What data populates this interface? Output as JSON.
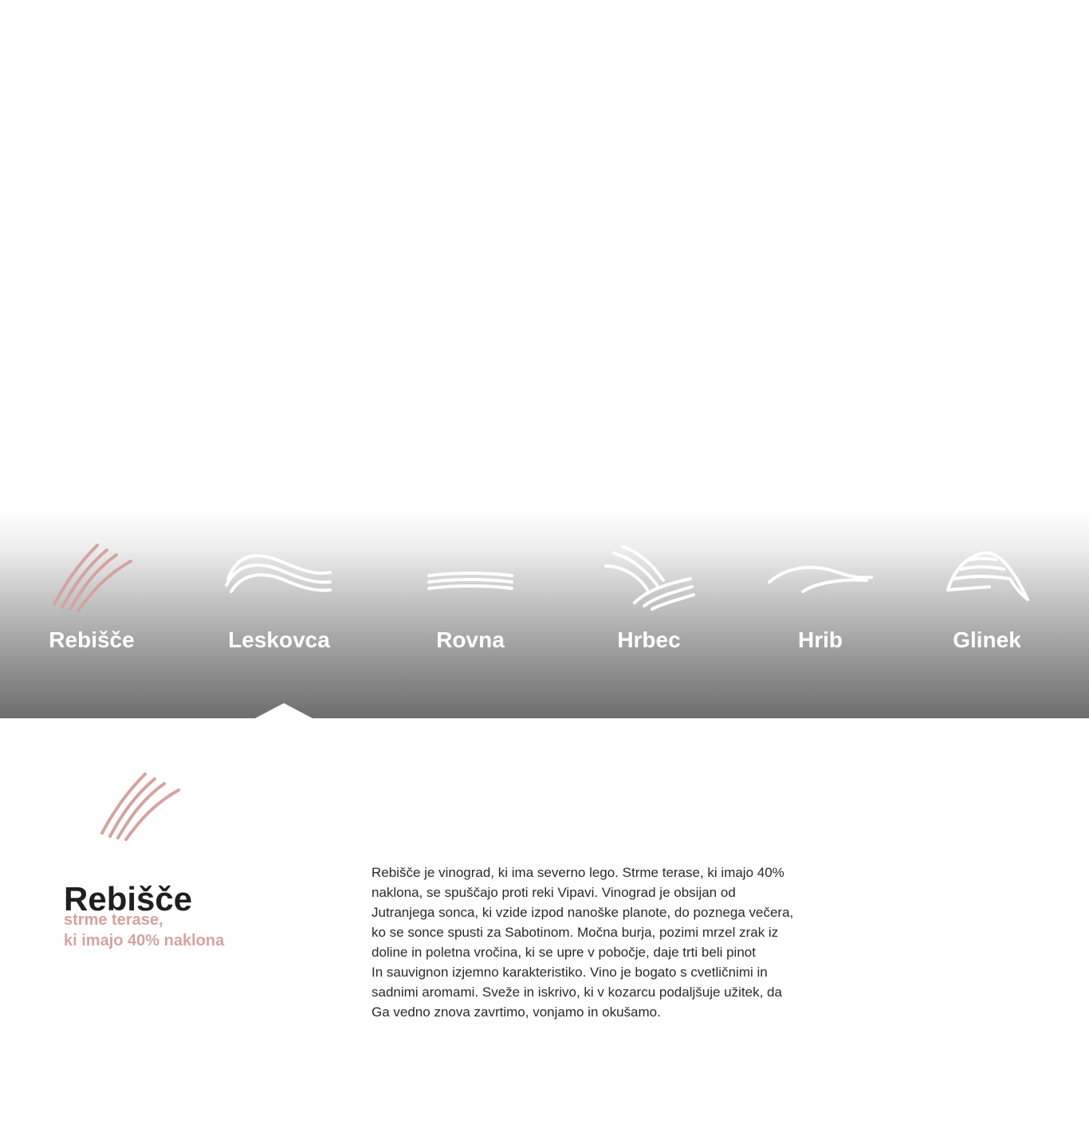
{
  "colors": {
    "accent": "#d4a3a0",
    "tab_text": "#ffffff",
    "title": "#1f1f1f",
    "body_text": "#2a2a2a"
  },
  "tabs": [
    {
      "label": "Rebišče",
      "icon": "diagonal-lines-icon",
      "active": true
    },
    {
      "label": "Leskovca",
      "icon": "wave-lines-icon",
      "active": false
    },
    {
      "label": "Rovna",
      "icon": "flat-lines-icon",
      "active": false
    },
    {
      "label": "Hrbec",
      "icon": "ridge-lines-icon",
      "active": false
    },
    {
      "label": "Hrib",
      "icon": "hill-curves-icon",
      "active": false
    },
    {
      "label": "Glinek",
      "icon": "layered-hill-icon",
      "active": false
    }
  ],
  "detail": {
    "icon": "diagonal-lines-icon",
    "title": "Rebišče",
    "subtitle_lines": [
      "strme terase,",
      "ki imajo 40% naklona"
    ],
    "description_lines": [
      "Rebišče je vinograd, ki ima severno lego. Strme terase, ki imajo 40%",
      "naklona, se spuščajo proti reki Vipavi. Vinograd je obsijan od",
      "Jutranjega sonca, ki vzide izpod nanoške planote, do poznega večera,",
      "ko se sonce spusti za Sabotinom. Močna burja, pozimi mrzel zrak iz",
      "doline in poletna vročina, ki se upre v pobočje, daje trti beli pinot",
      "In sauvignon izjemno karakteristiko. Vino je bogato s cvetličnimi in",
      "sadnimi aromami. Sveže in iskrivo, ki v kozarcu podaljšuje užitek, da",
      "Ga vedno znova zavrtimo, vonjamo in okušamo."
    ]
  }
}
